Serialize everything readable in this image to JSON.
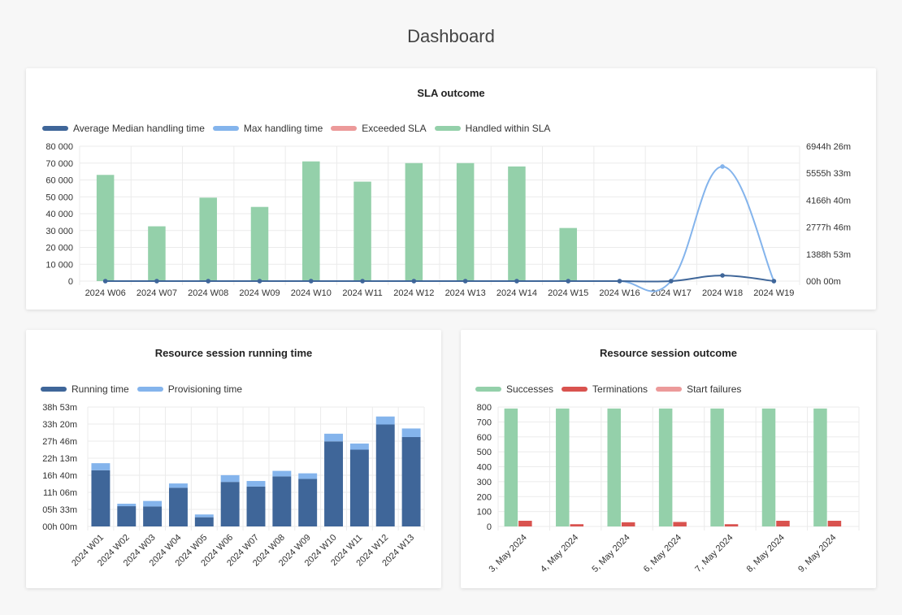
{
  "page": {
    "title": "Dashboard"
  },
  "colors": {
    "navy": "#3f6699",
    "lightblue": "#84b4ec",
    "salmon": "#ec9a9a",
    "green": "#94d0aa",
    "red": "#d9534f",
    "grid": "#ebebeb"
  },
  "chart_data": [
    {
      "id": "sla",
      "type": "bar",
      "title": "SLA outcome",
      "categories": [
        "2024 W06",
        "2024 W07",
        "2024 W08",
        "2024 W09",
        "2024 W10",
        "2024 W11",
        "2024 W12",
        "2024 W13",
        "2024 W14",
        "2024 W15",
        "2024 W16",
        "2024 W17",
        "2024 W18",
        "2024 W19"
      ],
      "left_axis": {
        "ticks": [
          "80 000",
          "70 000",
          "60 000",
          "50 000",
          "40 000",
          "30 000",
          "20 000",
          "10 000",
          "0"
        ],
        "ylim": [
          0,
          80000
        ]
      },
      "right_axis": {
        "ticks": [
          "6944h 26m",
          "5555h 33m",
          "4166h 40m",
          "2777h 46m",
          "1388h 53m",
          "00h 00m"
        ],
        "ylim_hours": [
          0,
          6944.44
        ]
      },
      "series": [
        {
          "name": "Average Median handling time",
          "kind": "line",
          "axis": "right",
          "color": "#3f6699",
          "values_hours": [
            0,
            0,
            0,
            0,
            0,
            0,
            0,
            0,
            0,
            0,
            0,
            0,
            290,
            0
          ]
        },
        {
          "name": "Max handling time",
          "kind": "line",
          "axis": "right",
          "color": "#84b4ec",
          "values_hours": [
            0,
            0,
            0,
            0,
            0,
            0,
            0,
            0,
            0,
            0,
            0,
            0,
            5900,
            0
          ]
        },
        {
          "name": "Exceeded SLA",
          "kind": "bar",
          "axis": "left",
          "color": "#ec9a9a",
          "values": [
            0,
            0,
            0,
            0,
            0,
            0,
            0,
            0,
            0,
            0,
            0,
            0,
            0,
            0
          ]
        },
        {
          "name": "Handled within SLA",
          "kind": "bar",
          "axis": "left",
          "color": "#94d0aa",
          "values": [
            63000,
            32500,
            49500,
            44000,
            71000,
            59000,
            70000,
            70000,
            68000,
            31500,
            0,
            0,
            0,
            0
          ]
        }
      ],
      "legend": "top-left",
      "grid": true
    },
    {
      "id": "running",
      "type": "bar",
      "title": "Resource session running time",
      "categories": [
        "2024 W01",
        "2024 W02",
        "2024 W03",
        "2024 W04",
        "2024 W05",
        "2024 W06",
        "2024 W07",
        "2024 W08",
        "2024 W09",
        "2024 W10",
        "2024 W11",
        "2024 W12",
        "2024 W13"
      ],
      "left_axis": {
        "ticks": [
          "38h 53m",
          "33h 20m",
          "27h 46m",
          "22h 13m",
          "16h 40m",
          "11h 06m",
          "05h 33m",
          "00h 00m"
        ],
        "ylim_hours": [
          0,
          38.89
        ]
      },
      "series": [
        {
          "name": "Running time",
          "color": "#3f6699",
          "values_hours": [
            18.3,
            6.6,
            6.5,
            12.6,
            3.0,
            14.5,
            13.0,
            16.3,
            15.5,
            27.7,
            25.0,
            33.2,
            29.1
          ]
        },
        {
          "name": "Provisioning time",
          "color": "#84b4ec",
          "values_hours": [
            2.3,
            0.8,
            1.8,
            1.4,
            0.9,
            2.2,
            1.8,
            1.8,
            1.8,
            2.5,
            2.0,
            2.6,
            2.8
          ]
        }
      ],
      "stacked": true,
      "legend": "top-left",
      "grid": true
    },
    {
      "id": "outcome",
      "type": "bar",
      "title": "Resource session outcome",
      "categories": [
        "3, May 2024",
        "4, May 2024",
        "5, May 2024",
        "6, May 2024",
        "7, May 2024",
        "8, May 2024",
        "9, May 2024"
      ],
      "left_axis": {
        "ticks": [
          "800",
          "700",
          "600",
          "500",
          "400",
          "300",
          "200",
          "100",
          "0"
        ],
        "ylim": [
          0,
          800
        ]
      },
      "series": [
        {
          "name": "Successes",
          "color": "#94d0aa",
          "values": [
            790,
            790,
            790,
            790,
            790,
            790,
            790
          ]
        },
        {
          "name": "Terminations",
          "color": "#d9534f",
          "values": [
            38,
            15,
            28,
            30,
            15,
            38,
            38
          ]
        },
        {
          "name": "Start failures",
          "color": "#ec9a9a",
          "values": [
            0,
            0,
            0,
            0,
            0,
            0,
            0
          ]
        }
      ],
      "legend": "top-left",
      "grid": true
    }
  ]
}
